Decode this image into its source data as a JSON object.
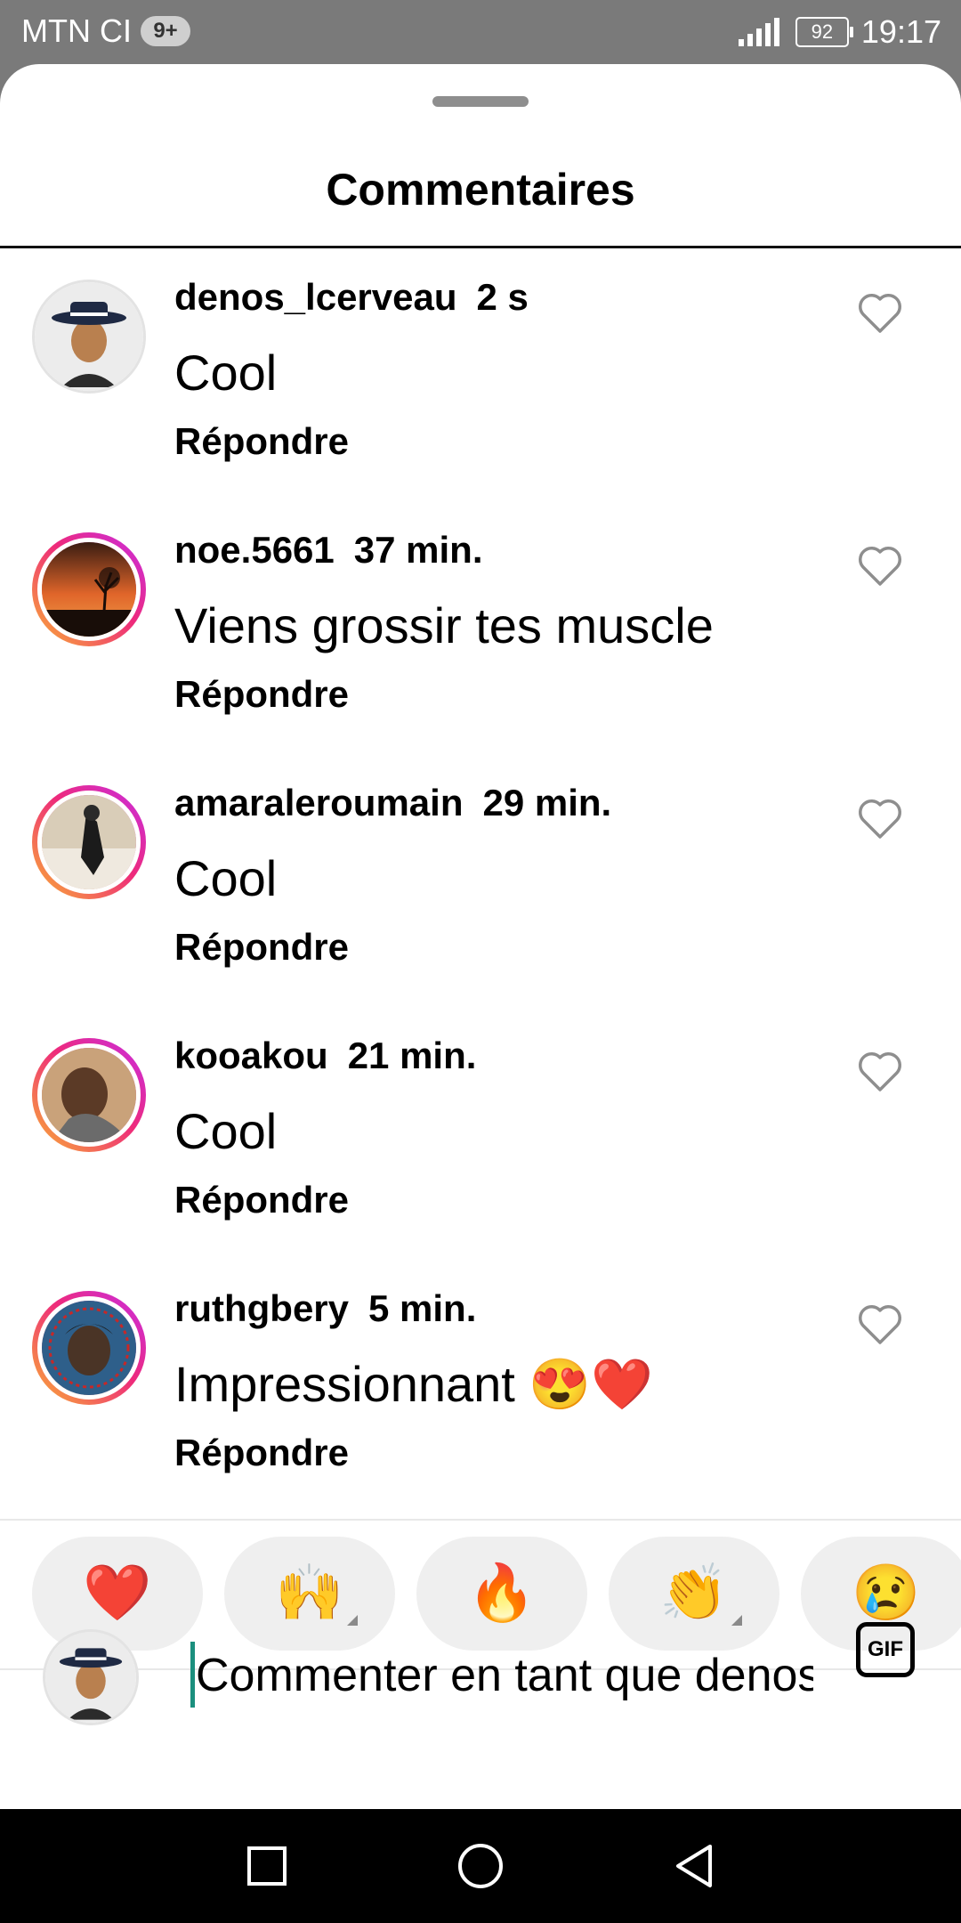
{
  "status_bar": {
    "carrier": "MTN CI",
    "notifications": "9+",
    "battery": "92",
    "time": "19:17"
  },
  "sheet": {
    "title": "Commentaires"
  },
  "comments": [
    {
      "username": "denos_lcerveau",
      "time": "2 s",
      "text": "Cool",
      "reply": "Répondre",
      "avatar": "bitmoji-avatar-icon"
    },
    {
      "username": "noe.5661",
      "time": "37 min.",
      "text": "Viens grossir tes muscle",
      "reply": "Répondre",
      "avatar": "sunset-avatar"
    },
    {
      "username": "amaraleroumain",
      "time": "29 min.",
      "text": "Cool",
      "reply": "Répondre",
      "avatar": "profile-photo"
    },
    {
      "username": "kooakou",
      "time": "21 min.",
      "text": "Cool",
      "reply": "Répondre",
      "avatar": "profile-photo"
    },
    {
      "username": "ruthgbery",
      "time": "5 min.",
      "text": "Impressionnant 😍❤️",
      "reply": "Répondre",
      "avatar": "profile-photo"
    }
  ],
  "reactions": [
    "❤️",
    "🙌",
    "🔥",
    "👏",
    "😢"
  ],
  "input": {
    "placeholder": "Commenter en tant que denos_lcerveau",
    "gif_label": "GIF"
  },
  "colors": {
    "ring_start": "#f9b233",
    "ring_end": "#c72ee6",
    "heart": "#e0245e",
    "cursor": "#1b8f7e"
  }
}
